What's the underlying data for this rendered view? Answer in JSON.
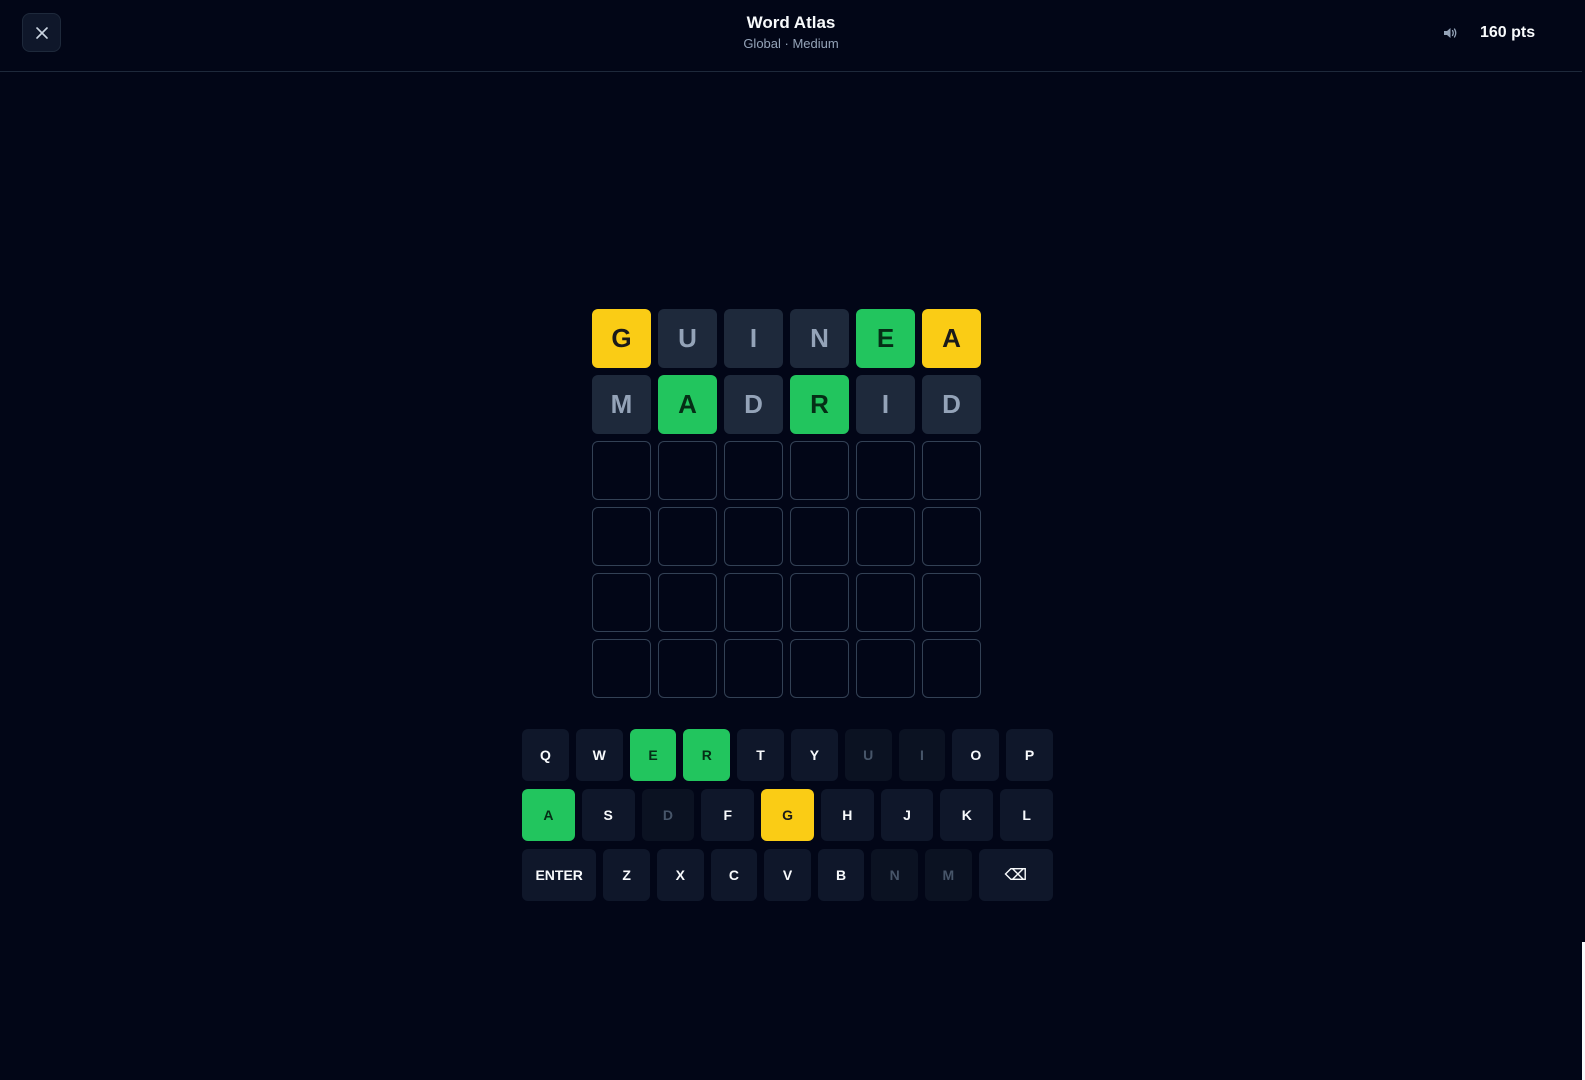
{
  "header": {
    "title": "Word Atlas",
    "subtitle": "Global · Medium",
    "score": "160 pts",
    "close_icon": "close-icon",
    "sound_icon": "speaker-icon"
  },
  "colors": {
    "correct": "#22c55e",
    "present": "#facc15",
    "absent": "#1e293b",
    "background": "#020617"
  },
  "board": {
    "rows": [
      [
        {
          "letter": "G",
          "state": "present"
        },
        {
          "letter": "U",
          "state": "absent"
        },
        {
          "letter": "I",
          "state": "absent"
        },
        {
          "letter": "N",
          "state": "absent"
        },
        {
          "letter": "E",
          "state": "correct"
        },
        {
          "letter": "A",
          "state": "present"
        }
      ],
      [
        {
          "letter": "M",
          "state": "absent"
        },
        {
          "letter": "A",
          "state": "correct"
        },
        {
          "letter": "D",
          "state": "absent"
        },
        {
          "letter": "R",
          "state": "correct"
        },
        {
          "letter": "I",
          "state": "absent"
        },
        {
          "letter": "D",
          "state": "absent"
        }
      ],
      [
        {
          "letter": "",
          "state": "empty"
        },
        {
          "letter": "",
          "state": "empty"
        },
        {
          "letter": "",
          "state": "empty"
        },
        {
          "letter": "",
          "state": "empty"
        },
        {
          "letter": "",
          "state": "empty"
        },
        {
          "letter": "",
          "state": "empty"
        }
      ],
      [
        {
          "letter": "",
          "state": "empty"
        },
        {
          "letter": "",
          "state": "empty"
        },
        {
          "letter": "",
          "state": "empty"
        },
        {
          "letter": "",
          "state": "empty"
        },
        {
          "letter": "",
          "state": "empty"
        },
        {
          "letter": "",
          "state": "empty"
        }
      ],
      [
        {
          "letter": "",
          "state": "empty"
        },
        {
          "letter": "",
          "state": "empty"
        },
        {
          "letter": "",
          "state": "empty"
        },
        {
          "letter": "",
          "state": "empty"
        },
        {
          "letter": "",
          "state": "empty"
        },
        {
          "letter": "",
          "state": "empty"
        }
      ],
      [
        {
          "letter": "",
          "state": "empty"
        },
        {
          "letter": "",
          "state": "empty"
        },
        {
          "letter": "",
          "state": "empty"
        },
        {
          "letter": "",
          "state": "empty"
        },
        {
          "letter": "",
          "state": "empty"
        },
        {
          "letter": "",
          "state": "empty"
        }
      ]
    ]
  },
  "keyboard": {
    "rows": [
      [
        {
          "label": "Q",
          "state": "unused"
        },
        {
          "label": "W",
          "state": "unused"
        },
        {
          "label": "E",
          "state": "correct"
        },
        {
          "label": "R",
          "state": "correct"
        },
        {
          "label": "T",
          "state": "unused"
        },
        {
          "label": "Y",
          "state": "unused"
        },
        {
          "label": "U",
          "state": "absent"
        },
        {
          "label": "I",
          "state": "absent"
        },
        {
          "label": "O",
          "state": "unused"
        },
        {
          "label": "P",
          "state": "unused"
        }
      ],
      [
        {
          "label": "A",
          "state": "correct"
        },
        {
          "label": "S",
          "state": "unused"
        },
        {
          "label": "D",
          "state": "absent"
        },
        {
          "label": "F",
          "state": "unused"
        },
        {
          "label": "G",
          "state": "present"
        },
        {
          "label": "H",
          "state": "unused"
        },
        {
          "label": "J",
          "state": "unused"
        },
        {
          "label": "K",
          "state": "unused"
        },
        {
          "label": "L",
          "state": "unused"
        }
      ],
      [
        {
          "label": "ENTER",
          "state": "unused",
          "kind": "enter"
        },
        {
          "label": "Z",
          "state": "unused"
        },
        {
          "label": "X",
          "state": "unused"
        },
        {
          "label": "C",
          "state": "unused"
        },
        {
          "label": "V",
          "state": "unused"
        },
        {
          "label": "B",
          "state": "unused"
        },
        {
          "label": "N",
          "state": "absent"
        },
        {
          "label": "M",
          "state": "absent"
        },
        {
          "label": "⌫",
          "state": "unused",
          "kind": "backspace"
        }
      ]
    ]
  }
}
